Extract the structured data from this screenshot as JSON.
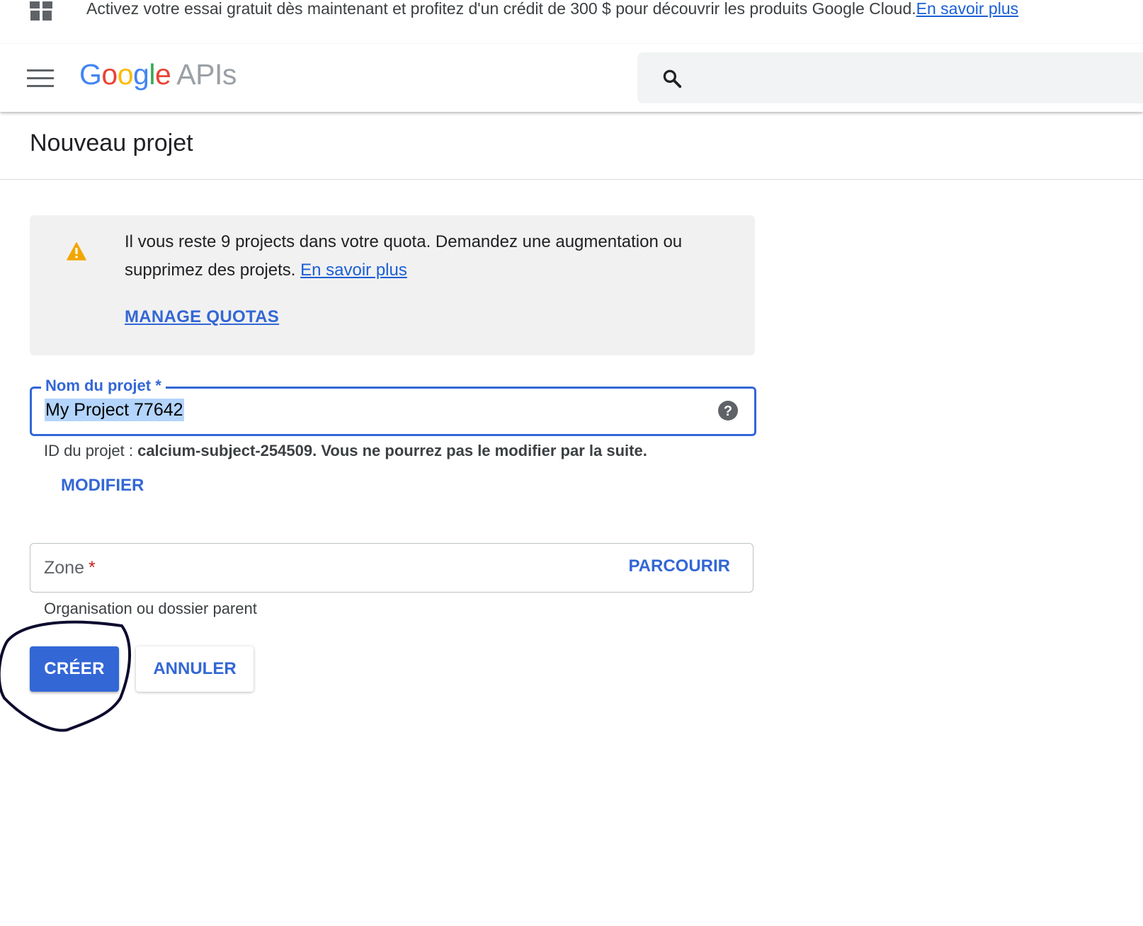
{
  "promo_banner": {
    "icon": "gift-icon",
    "text": "Activez votre essai gratuit dès maintenant et profitez d'un crédit de 300 $ pour découvrir les produits Google Cloud.",
    "link_label": "En savoir plus"
  },
  "header": {
    "menu_icon": "hamburger-menu-icon",
    "logo": {
      "g1": "G",
      "o1": "o",
      "o2": "o",
      "g2": "g",
      "l": "l",
      "e": "e",
      "product": "APIs"
    },
    "search_icon": "search-icon",
    "search_placeholder": ""
  },
  "page": {
    "title": "Nouveau projet"
  },
  "quota_notice": {
    "icon": "warning-icon",
    "message": "Il vous reste 9 projects dans votre quota. Demandez une augmentation ou supprimez des projets.",
    "link_label": "En savoir plus",
    "action_label": "MANAGE QUOTAS"
  },
  "project_name": {
    "label": "Nom du projet *",
    "value": "My Project 77642",
    "help_icon": "help-circle-icon"
  },
  "project_id": {
    "prefix": "ID du projet : ",
    "id": "calcium-subject-254509",
    "note": ". Vous ne pourrez pas le modifier par la suite.",
    "modify_label": "MODIFIER"
  },
  "zone": {
    "label": "Zone",
    "required_mark": "*",
    "browse_label": "PARCOURIR",
    "helper": "Organisation ou dossier parent"
  },
  "actions": {
    "create_label": "CRÉER",
    "cancel_label": "ANNULER"
  },
  "colors": {
    "accent": "#3367d6",
    "link": "#1a5fd6",
    "warning": "#f2a600",
    "annotation_ink": "#0d0b2e"
  }
}
